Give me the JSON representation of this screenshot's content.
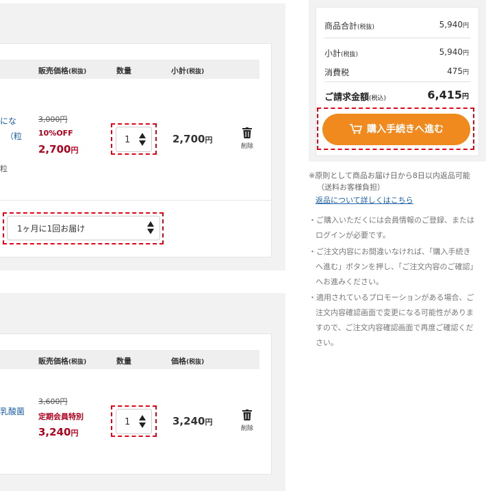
{
  "section1": {
    "headers": {
      "price": "販売価格",
      "price_tax": "(税抜)",
      "qty": "数量",
      "subtotal": "小計",
      "subtotal_tax": "(税抜)"
    },
    "product_name_lines": [
      "にな",
      "（粒",
      "粒"
    ],
    "original_price": "3,000円",
    "discount": "10%OFF",
    "sale_price": "2,700",
    "sale_price_unit": "円",
    "quantity": "1",
    "subtotal": "2,700",
    "subtotal_unit": "円",
    "delete_label": "削除",
    "delivery_cycle": "1ヶ月に1回お届け"
  },
  "section2": {
    "headers": {
      "price": "販売価格",
      "price_tax": "(税抜)",
      "qty": "数量",
      "total": "価格",
      "total_tax": "(税抜)"
    },
    "product_name_lines": [
      "乳酸菌"
    ],
    "original_price": "3,600円",
    "discount": "定期会員特別",
    "sale_price": "3,240",
    "sale_price_unit": "円",
    "quantity": "1",
    "price": "3,240",
    "price_unit": "円",
    "delete_label": "削除"
  },
  "summary": {
    "items_total_label": "商品合計",
    "items_total_tax": "(税抜)",
    "items_total_value": "5,940",
    "subtotal_label": "小計",
    "subtotal_tax": "(税抜)",
    "subtotal_value": "5,940",
    "tax_label": "消費税",
    "tax_value": "475",
    "total_label": "ご請求金額",
    "total_tax": "(税込)",
    "total_value": "6,415",
    "yen": "円",
    "checkout_button": "購入手続きへ進む"
  },
  "notes": {
    "returns_line1": "※原則として商品お届け日から8日以内返品可能",
    "returns_line2": "（送料お客様負担）",
    "returns_link": "返品について詳しくはこちら",
    "items": [
      [
        "・ご購入いただくには会員情報のご登録、または",
        "ログインが必要です。"
      ],
      [
        "・ご注文内容にお間違いなければ、「購入手続き",
        "へ進む」ボタンを押し、「ご注文内容のご確認」",
        "へお進みください。"
      ],
      [
        "・適用されているプロモーションがある場合、ご",
        "注文内容確認画面で変更になる可能性がありま",
        "すので、ご注文内容確認画面で再度ご確認くだ",
        "さい。"
      ]
    ]
  },
  "colors": {
    "accent_orange": "#f08a1e",
    "price_red": "#b0001e",
    "highlight_dash": "#e60012",
    "link_blue": "#1a5ea8"
  }
}
